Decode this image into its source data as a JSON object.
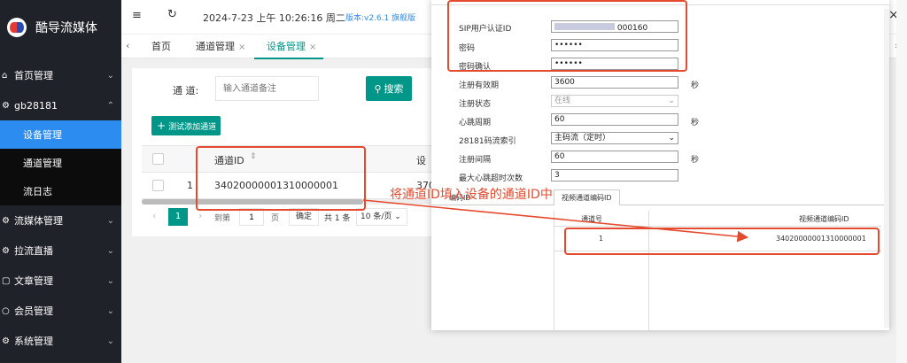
{
  "app": {
    "title": "酷导流媒体"
  },
  "topbar": {
    "menu_icon": "≡",
    "refresh_icon": "↻",
    "datetime": "2024-7-23 上午 10:26:16 周二",
    "version": "版本:v2.6.1 旗舰版",
    "close_icon": "×"
  },
  "sidebar": {
    "items": [
      {
        "label": "首页管理"
      },
      {
        "label": "gb28181"
      },
      {
        "label": "设备管理"
      },
      {
        "label": "通道管理"
      },
      {
        "label": "流日志"
      },
      {
        "label": "流媒体管理"
      },
      {
        "label": "拉流直播"
      },
      {
        "label": "文章管理"
      },
      {
        "label": "会员管理"
      },
      {
        "label": "系统管理"
      }
    ]
  },
  "tabs": [
    {
      "label": "首页"
    },
    {
      "label": "通道管理"
    },
    {
      "label": "设备管理"
    }
  ],
  "search": {
    "label": "通 道:",
    "placeholder": "输入通道备注",
    "button": "搜索"
  },
  "toolbar": {
    "add_label": "测试添加通道"
  },
  "table": {
    "headers": [
      "通道ID",
      "设"
    ],
    "rows": [
      {
        "index": "1",
        "channel_id": "34020000001310000001",
        "col2": "370"
      }
    ]
  },
  "pager": {
    "current": "1",
    "goto_prefix": "到第",
    "goto_value": "1",
    "goto_suffix": "页",
    "confirm": "确定",
    "total": "共 1 条",
    "size": "10 条/页"
  },
  "dialog": {
    "fields": [
      {
        "label": "SIP用户认证ID",
        "value": "000160"
      },
      {
        "label": "密码",
        "value": "••••••"
      },
      {
        "label": "密码确认",
        "value": "••••••"
      },
      {
        "label": "注册有效期",
        "value": "3600",
        "unit": "秒"
      },
      {
        "label": "注册状态",
        "value": "在线"
      },
      {
        "label": "心跳周期",
        "value": "60",
        "unit": "秒"
      },
      {
        "label": "28181码流索引",
        "value": "主码流（定时）"
      },
      {
        "label": "注册间隔",
        "value": "60",
        "unit": "秒"
      },
      {
        "label": "最大心跳超时次数",
        "value": "3"
      }
    ],
    "sub_tabs": [
      "编码ID",
      "视频通道编码ID"
    ],
    "table": {
      "headers": [
        "通道号",
        "视频通道编码ID"
      ],
      "rows": [
        {
          "no": "1",
          "id": "34020000001310000001"
        }
      ]
    }
  },
  "annotation": {
    "text": "将通道ID填入设备的通道ID中",
    "color": "#e64a2e"
  }
}
